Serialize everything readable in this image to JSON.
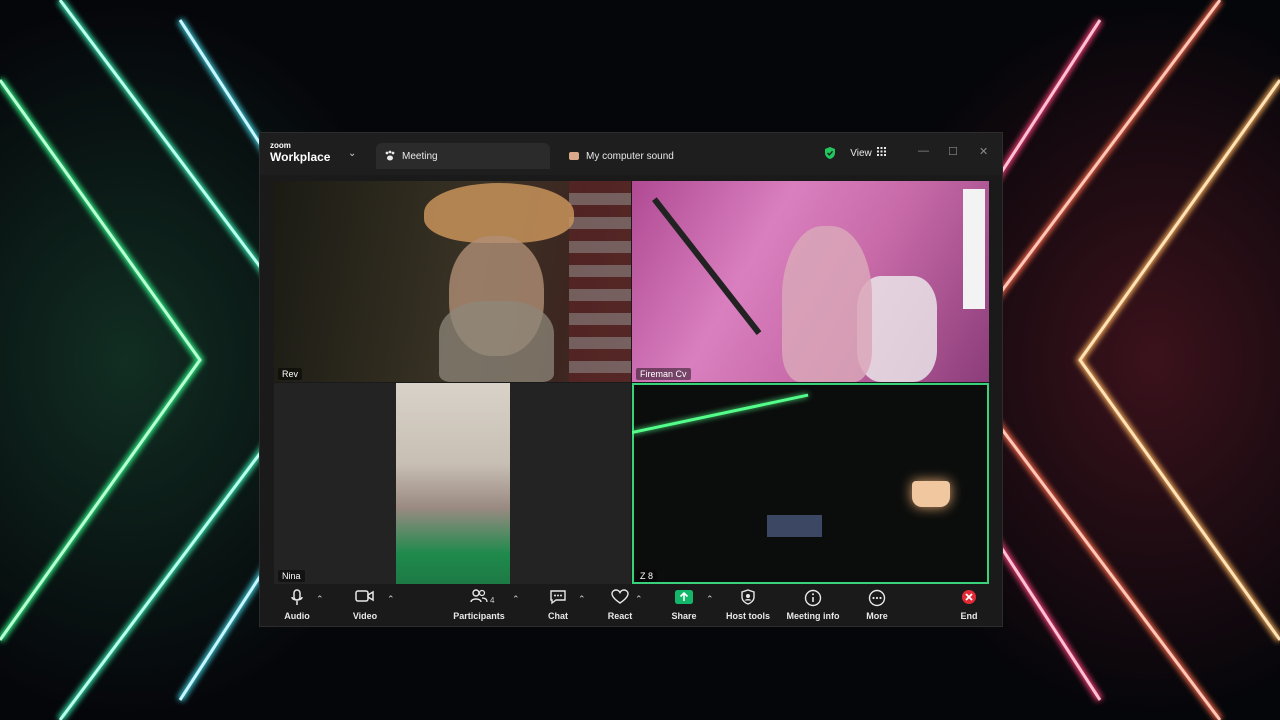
{
  "app": {
    "brand_small": "zoom",
    "brand_name": "Workplace"
  },
  "tabs": [
    {
      "label": "Meeting",
      "icon": "paw-icon"
    },
    {
      "label": "My computer sound",
      "icon": "computer-sound-icon"
    }
  ],
  "header": {
    "view_label": "View",
    "security_color": "#22c55e"
  },
  "participants": [
    {
      "name": "Rev"
    },
    {
      "name": "Fireman Cv"
    },
    {
      "name": "Nina"
    },
    {
      "name": "Z 8",
      "active_speaker": true
    }
  ],
  "toolbar": {
    "audio": "Audio",
    "video": "Video",
    "participants": "Participants",
    "participants_count": "4",
    "chat": "Chat",
    "react": "React",
    "share": "Share",
    "host_tools": "Host tools",
    "meeting_info": "Meeting info",
    "more": "More",
    "end": "End"
  },
  "colors": {
    "share_green": "#12b76a",
    "end_red": "#e02b36",
    "speaker_border": "#39d17a"
  }
}
